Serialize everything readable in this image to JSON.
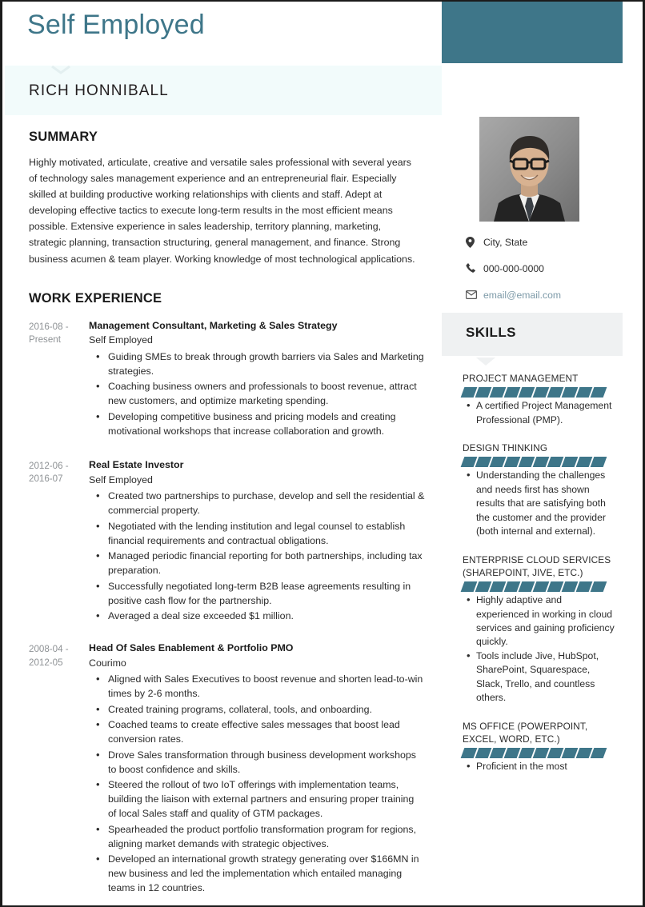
{
  "document": {
    "type": "resume",
    "headline": "Self Employed",
    "name": "RICH HONNIBALL"
  },
  "colors": {
    "accent_teal": "#3e7689",
    "name_band": "#f2fbfb",
    "skills_band": "#eff1f2",
    "date_gray": "#8e9295",
    "email_link": "#7d9aa8"
  },
  "sections": {
    "summary": {
      "title": "SUMMARY",
      "text": "Highly motivated, articulate, creative and versatile sales professional with several years of technology sales management experience and an entrepreneurial flair. Especially skilled at building productive working relationships with clients and staff. Adept at developing effective tactics to execute long-term results in the most efficient means possible. Extensive experience in sales leadership, territory planning, marketing, strategic planning, transaction structuring, general management, and finance. Strong business acumen & team player. Working knowledge of most technological applications."
    },
    "work_experience": {
      "title": "WORK EXPERIENCE",
      "jobs": [
        {
          "dates": "2016-08 - Present",
          "role": "Management Consultant, Marketing & Sales Strategy",
          "employer": "Self Employed",
          "bullets": [
            "Guiding SMEs to break through growth barriers via Sales and Marketing strategies.",
            "Coaching business owners and professionals to boost revenue, attract new customers, and optimize marketing spending.",
            "Developing competitive business and pricing models and creating motivational workshops that increase collaboration and growth."
          ]
        },
        {
          "dates": "2012-06 - 2016-07",
          "role": "Real Estate Investor",
          "employer": "Self Employed",
          "bullets": [
            "Created two partnerships to purchase, develop and sell the residential & commercial property.",
            "Negotiated with the lending institution and legal counsel to establish financial requirements and contractual obligations.",
            "Managed periodic financial reporting for both partnerships, including tax preparation.",
            "Successfully negotiated long-term B2B lease agreements resulting in positive cash flow for the partnership.",
            "Averaged a deal size exceeded $1 million."
          ]
        },
        {
          "dates": "2008-04 - 2012-05",
          "role": "Head Of Sales Enablement & Portfolio PMO",
          "employer": "Courimo",
          "bullets": [
            "Aligned with Sales Executives to boost revenue and shorten lead-to-win times by 2-6 months.",
            "Created training programs, collateral, tools, and onboarding.",
            "Coached teams to create effective sales messages that boost lead conversion rates.",
            "Drove Sales transformation through business development workshops to boost confidence and skills.",
            "Steered the rollout of two IoT offerings with implementation teams, building the liaison with external partners and ensuring proper training of local Sales staff and quality of GTM packages.",
            "Spearheaded the product portfolio transformation program for regions, aligning market demands with strategic objectives.",
            "Developed an international growth strategy generating over $166MN in new business and led the implementation which entailed managing teams in 12 countries."
          ]
        }
      ]
    }
  },
  "sidebar": {
    "photo_alt": "headshot-photo",
    "contact": [
      {
        "icon": "location-pin-icon",
        "value": "City, State"
      },
      {
        "icon": "phone-icon",
        "value": "000-000-0000"
      },
      {
        "icon": "envelope-icon",
        "value": "email@email.com"
      }
    ],
    "skills_title": "SKILLS",
    "skills": [
      {
        "name": "PROJECT MANAGEMENT",
        "segments": 10,
        "filled": 10,
        "bullets": [
          "A certified Project Management Professional (PMP)."
        ]
      },
      {
        "name": "DESIGN THINKING",
        "segments": 10,
        "filled": 10,
        "bullets": [
          "Understanding the challenges and needs first has shown results that are satisfying both the customer and the provider (both internal and external)."
        ]
      },
      {
        "name": "ENTERPRISE CLOUD SERVICES (SHAREPOINT, JIVE, ETC.)",
        "segments": 10,
        "filled": 10,
        "bullets": [
          "Highly adaptive and experienced in working in cloud services and gaining proficiency quickly.",
          "Tools include Jive, HubSpot, SharePoint, Squarespace, Slack, Trello, and countless others."
        ]
      },
      {
        "name": "MS OFFICE (POWERPOINT, EXCEL, WORD, ETC.)",
        "segments": 10,
        "filled": 10,
        "bullets": [
          "Proficient in the most"
        ]
      }
    ]
  }
}
